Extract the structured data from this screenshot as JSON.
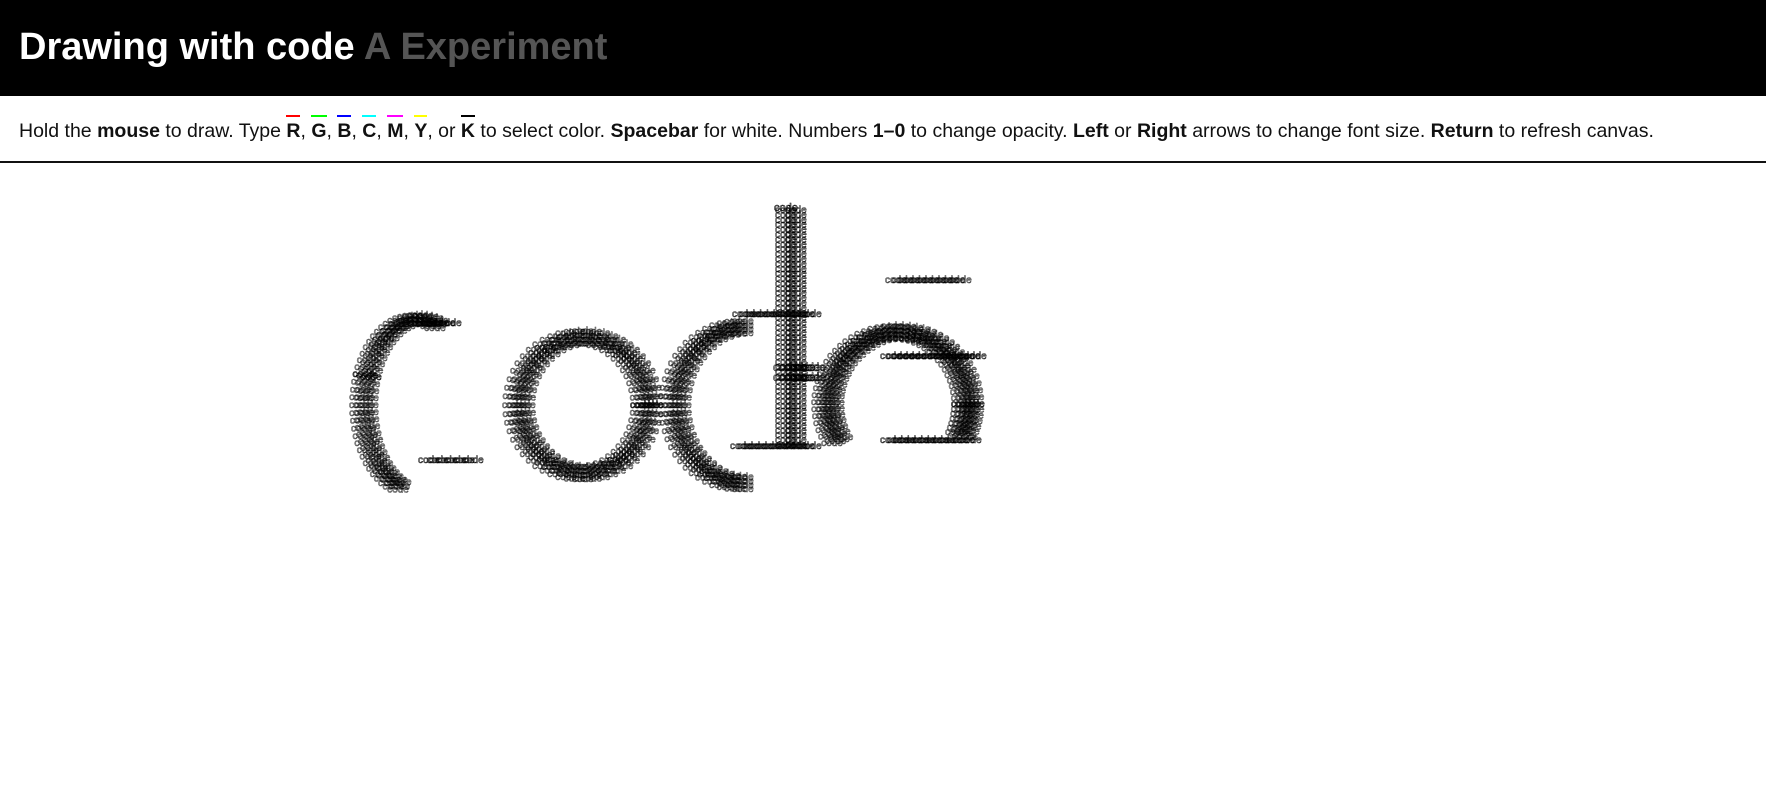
{
  "header": {
    "title": "Drawing with code",
    "subtitle": "A Experiment"
  },
  "instructions": {
    "t1": "Hold the ",
    "mouse": "mouse",
    "t2": " to draw. Type ",
    "color_keys": [
      {
        "key": "R",
        "color": "#ff0000"
      },
      {
        "key": "G",
        "color": "#00ff00"
      },
      {
        "key": "B",
        "color": "#0000ff"
      },
      {
        "key": "C",
        "color": "#00ffff"
      },
      {
        "key": "M",
        "color": "#ff00ff"
      },
      {
        "key": "Y",
        "color": "#ffff00"
      },
      {
        "key": "K",
        "color": "#000000"
      }
    ],
    "sep": ", ",
    "or": ", or ",
    "t3": " to select color. ",
    "spacebar": "Spacebar",
    "t4": " for white. Numbers ",
    "range": "1–0",
    "t5": " to change opacity. ",
    "left": "Left",
    "t6": " or ",
    "right": "Right",
    "t7": " arrows to change font size. ",
    "return": "Return",
    "t8": " to refresh canvas."
  },
  "canvas": {
    "stamp_text": "code",
    "brush_color": "#000000"
  }
}
